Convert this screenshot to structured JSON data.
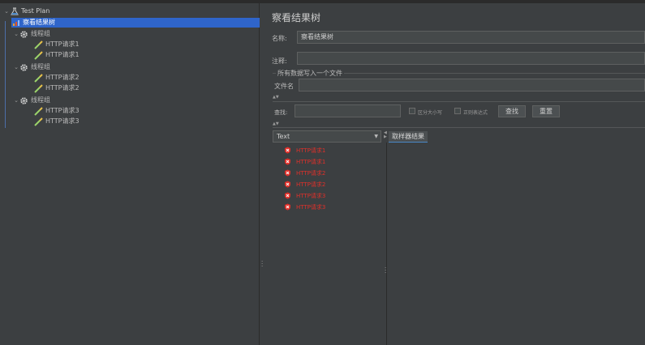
{
  "tree": {
    "root": "Test Plan",
    "selected_item": "察看结果树",
    "groups": [
      {
        "label": "线程组",
        "requests": [
          "HTTP请求1",
          "HTTP请求1"
        ]
      },
      {
        "label": "线程组",
        "requests": [
          "HTTP请求2",
          "HTTP请求2"
        ]
      },
      {
        "label": "线程组",
        "requests": [
          "HTTP请求3",
          "HTTP请求3"
        ]
      }
    ]
  },
  "panel": {
    "title": "察看结果树",
    "name_label": "名称:",
    "name_value": "察看结果树",
    "comment_label": "注释:",
    "comment_value": "",
    "write_all_label": "所有数据写入一个文件",
    "filename_label": "文件名",
    "filename_value": "",
    "search_label": "查找:",
    "search_value": "",
    "case_sensitive_label": "区分大小写",
    "regex_label": "正则表达式",
    "find_button": "查找",
    "reset_button": "重置",
    "renderer_select": "Text",
    "detail_tab": "取样器结果",
    "results": [
      "HTTP请求1",
      "HTTP请求1",
      "HTTP请求2",
      "HTTP请求2",
      "HTTP请求3",
      "HTTP请求3"
    ]
  },
  "colors": {
    "error": "#e0302a",
    "selection": "#2f65ca"
  }
}
